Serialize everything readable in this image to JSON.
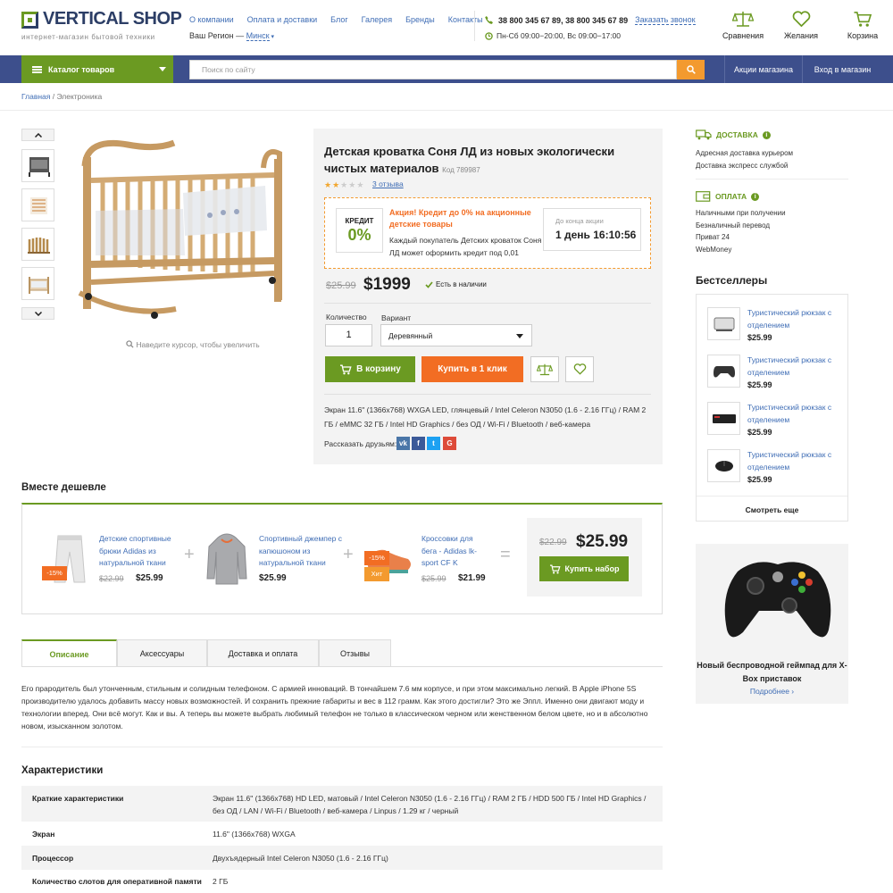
{
  "header": {
    "logo_text": "VERTICAL SHOP",
    "logo_sub": "интернет-магазин бытовой техники",
    "nav": [
      "О компании",
      "Оплата и доставки",
      "Блог",
      "Галерея",
      "Бренды",
      "Контакты"
    ],
    "region_label": "Ваш Регион —",
    "region_city": "Минск",
    "phones": "38 800 345 67 89,  38 800 345 67 89",
    "callback": "Заказать звонок",
    "hours": "Пн-Сб 09:00−20:00, Вс 09:00−17:00",
    "icons": [
      {
        "label": "Сравнения",
        "icon": "scales-icon"
      },
      {
        "label": "Желания",
        "icon": "heart-icon"
      },
      {
        "label": "Корзина",
        "icon": "cart-icon"
      }
    ]
  },
  "navbar": {
    "catalog": "Каталог товаров",
    "search_placeholder": "Поиск по сайту",
    "links": [
      "Акции магазина",
      "Вход  в магазин"
    ],
    "bg_color": "#3d4f8c",
    "accent_color": "#6b9a22"
  },
  "breadcrumb": {
    "home": "Главная",
    "sep": " / ",
    "current": "Электроника"
  },
  "gallery": {
    "zoom_hint": "Наведите курсор, чтобы увеличить"
  },
  "product": {
    "title": "Детская кроватка Соня ЛД из новых экологически чистых материалов",
    "code": "Код 789987",
    "rating": 2,
    "rating_max": 5,
    "reviews": "3 отзыва",
    "credit_label": "КРЕДИТ",
    "credit_value": "0%",
    "promo_title": "Акция! Кредит до 0% на акционные детские товары",
    "promo_text": "Каждый покупатель Детских кроваток Соня ЛД может оформить кредит под 0,01",
    "timer_label": "До конца акции",
    "timer_value": "1 день 16:10:56",
    "old_price": "$25.99",
    "price": "$1999",
    "stock": "Есть в наличии",
    "qty_label": "Количество",
    "qty_value": "1",
    "variant_label": "Вариант",
    "variant_value": "Деревянный",
    "cart_button": "В корзину",
    "one_click": "Купить в 1 клик",
    "specs": "Экран 11.6\" (1366x768) WXGA LED, глянцевый / Intel Celeron N3050 (1.6 - 2.16 ГГц) / RAM 2 ГБ / eMMC 32 ГБ / Intel HD Graphics / без ОД / Wi-Fi / Bluetooth / веб-камера",
    "share_label": "Рассказать друзьям:"
  },
  "sidebar": {
    "delivery_title": "ДОСТАВКА",
    "delivery_items": [
      "Адресная доставка курьером",
      "Доставка экспресс службой"
    ],
    "payment_title": "ОПЛАТА",
    "payment_items": [
      "Наличными при получении",
      "Безналичный перевод",
      "Приват 24",
      "WebMoney"
    ],
    "best_title": "Бестселлеры",
    "best_items": [
      {
        "name": "Туристический рюкзак с отделением",
        "price": "$25.99",
        "icon": "console-icon"
      },
      {
        "name": "Туристический рюкзак с отделением",
        "price": "$25.99",
        "icon": "gamepad-icon"
      },
      {
        "name": "Туристический рюкзак с отделением",
        "price": "$25.99",
        "icon": "keyboard-icon"
      },
      {
        "name": "Туристический рюкзак с отделением",
        "price": "$25.99",
        "icon": "mouse-icon"
      }
    ],
    "see_more": "Смотреть еще",
    "promo_name": "Новый беспроводной геймпад для  X-Box приставок",
    "promo_more": "Подробнее ›"
  },
  "together": {
    "title": "Вместе дешевле",
    "items": [
      {
        "name": "Детские спортивные брюки Adidas из натуральной ткани",
        "old": "$22.99",
        "price": "$25.99",
        "badge": "-15%"
      },
      {
        "name": "Спортивный джемпер с капюшоном из натуральной ткани",
        "price": "$25.99"
      },
      {
        "name": "Кроссовки для бега - Adidas lk-sport CF K",
        "old": "$25.99",
        "price": "$21.99",
        "badge": "-15%",
        "badge2": "Хит"
      }
    ],
    "total_old": "$22.99",
    "total_new": "$25.99",
    "buy_set": "Купить набор"
  },
  "tabs": [
    "Описание",
    "Аксессуары",
    "Доставка и оплата",
    "Отзывы"
  ],
  "description": "Его прародитель был утонченным, стильным и солидным телефоном. С армией инноваций. В тончайшем 7.6 мм корпусе, и при этом максимально легкий. В Apple iPhone 5S производителю удалось добавить массу новых возможностей. И сохранить прежние габариты и вес в 112 грамм. Как этого достигли? Это же Эппл. Именно они двигают моду и технологии вперед. Они всё могут. Как и вы. А теперь вы можете выбрать любимый телефон не только в классическом черном или женственном белом цвете, но и в абсолютно новом, изысканном золотом.",
  "characteristics": {
    "title": "Характеристики",
    "rows": [
      {
        "k": "Краткие характеристики",
        "v": "Экран 11.6\" (1366x768) HD LED, матовый / Intel Celeron N3050 (1.6 - 2.16 ГГц) / RAM 2 ГБ / HDD 500 ГБ / Intel HD Graphics / без ОД / LAN / Wi-Fi / Bluetooth / веб-камера / Linpus / 1.29 кг / черный"
      },
      {
        "k": "Экран",
        "v": "11.6\" (1366x768) WXGA"
      },
      {
        "k": "Процессор",
        "v": "Двухъядерный Intel Celeron N3050 (1.6 - 2.16 ГГц)"
      },
      {
        "k": "Количество слотов для оперативной памяти",
        "v": "2 ГБ"
      }
    ]
  }
}
